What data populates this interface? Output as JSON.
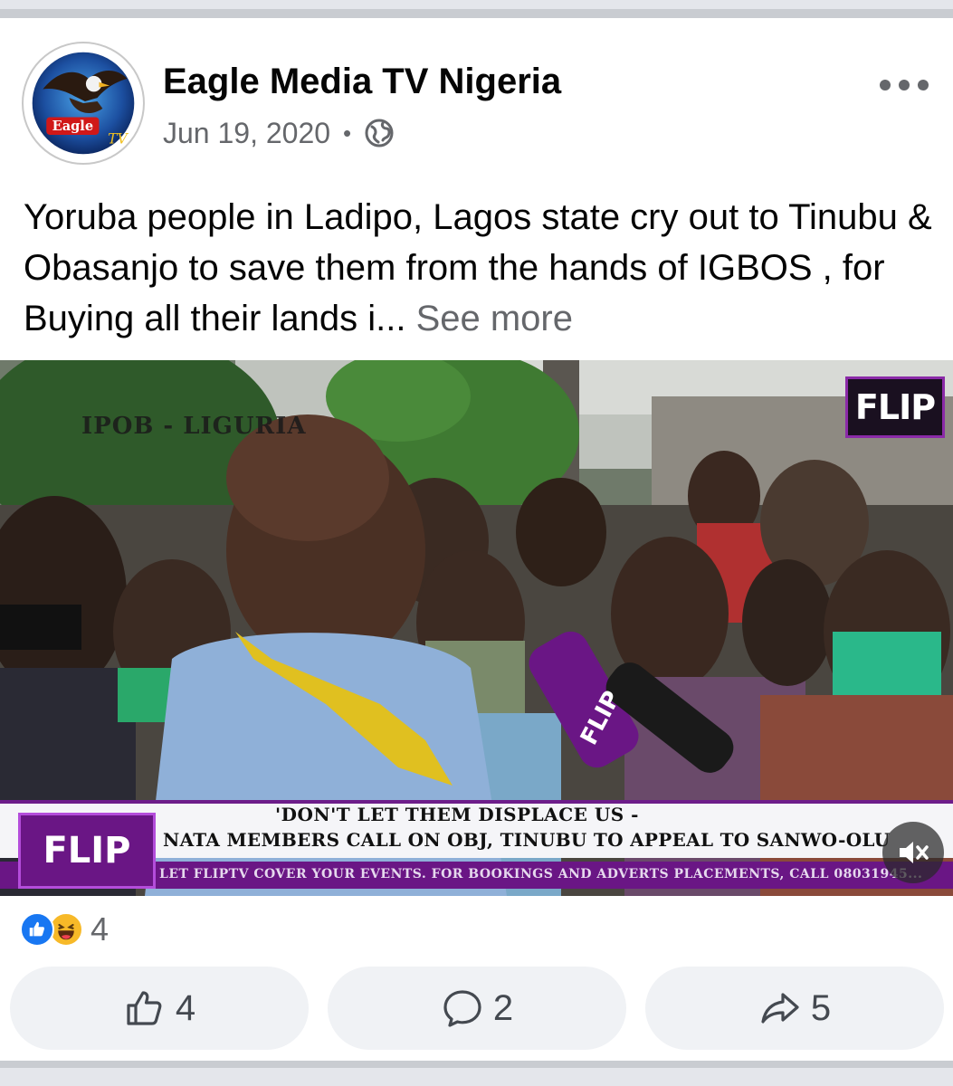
{
  "post": {
    "page_name": "Eagle Media TV Nigeria",
    "date": "Jun 19, 2020",
    "separator": "•",
    "privacy_icon": "globe-icon",
    "avatar_label": "Eagle TV",
    "text": "Yoruba people in Ladipo, Lagos state cry out to Tinubu & Obasanjo to save them from the hands of IGBOS , for Buying all their lands i...",
    "see_more": "See more"
  },
  "video": {
    "watermark": "IPOB - LIGURIA",
    "brand_logo": "FLIP",
    "headline_line1": "'DON'T LET THEM DISPLACE US -",
    "headline_line2": "NATA MEMBERS CALL ON OBJ, TINUBU TO APPEAL TO SANWO-OLU",
    "ticker": "LET FLIPTV COVER YOUR EVENTS. FOR BOOKINGS AND ADVERTS PLACEMENTS, CALL 08031945...",
    "mute_icon": "speaker-muted-icon"
  },
  "reactions": {
    "icons": [
      "like-reaction-icon",
      "haha-reaction-icon"
    ],
    "count": "4"
  },
  "actions": {
    "like_count": "4",
    "comment_count": "2",
    "share_count": "5"
  },
  "colors": {
    "brand_blue": "#1877f2",
    "text_secondary": "#65676b",
    "button_bg": "#f0f2f5",
    "flip_purple": "#6a1685"
  }
}
